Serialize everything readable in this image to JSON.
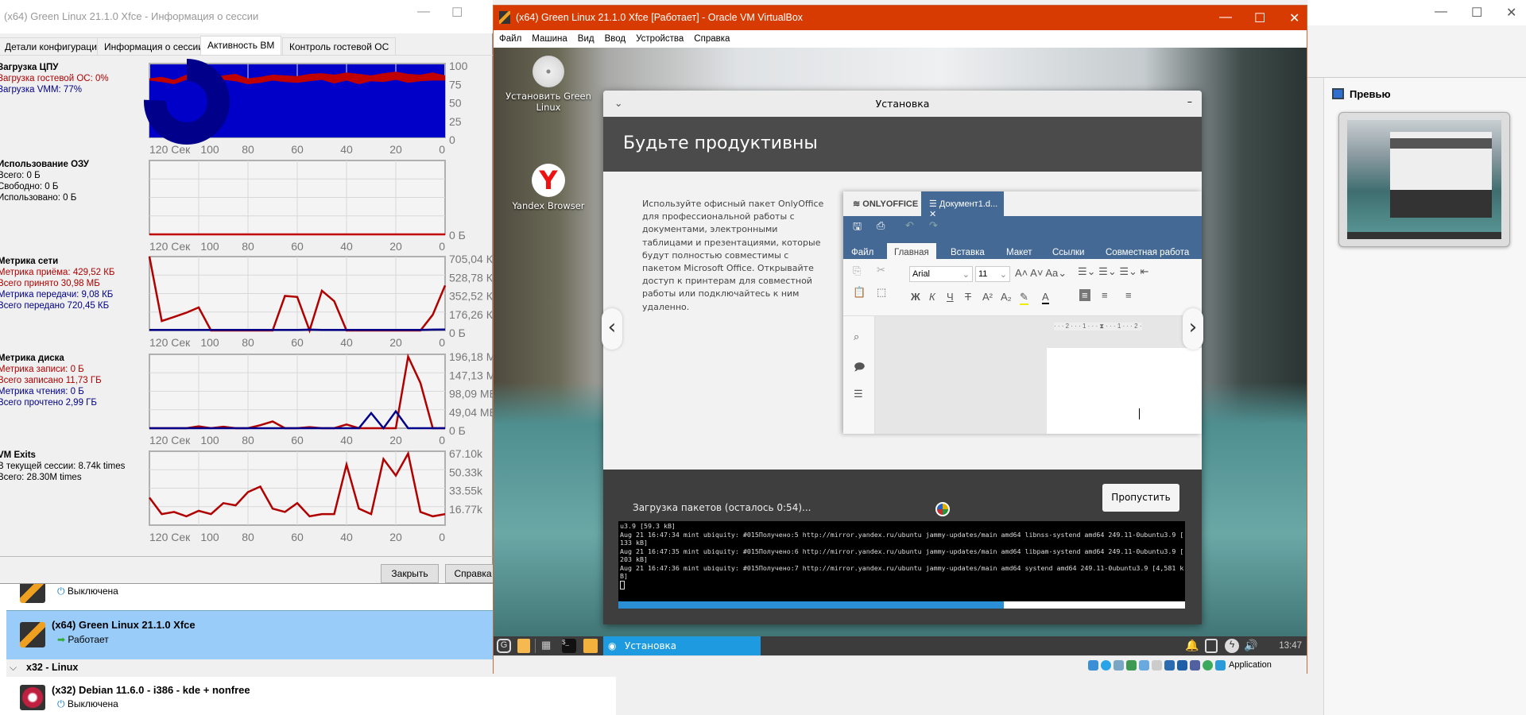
{
  "manager": {
    "preview_title": "Превью",
    "vm_list": [
      {
        "name": "",
        "state": "Выключена"
      },
      {
        "name": "(x64) Green Linux 21.1.0 Xfce",
        "state": "Работает",
        "selected": true
      },
      {
        "group": "x32 - Linux"
      },
      {
        "name": "(x32) Debian 11.6.0 - i386 - kde + nonfree",
        "state": "Выключена"
      }
    ]
  },
  "session_window": {
    "title": "(x64) Green Linux 21.1.0 Xfce - Информация о сессии",
    "tabs": [
      "Детали конфигурации",
      "Информация о сессии",
      "Активность ВМ",
      "Контроль гостевой ОС"
    ],
    "active_tab": "Активность ВМ",
    "buttons": {
      "close": "Закрыть",
      "help": "Справка"
    },
    "sections": {
      "cpu": {
        "title": "Загрузка ЦПУ",
        "lines": [
          "Загрузка гостевой ОС: 0%",
          "Загрузка VMM: 77%"
        ]
      },
      "ram": {
        "title": "Использование ОЗУ",
        "lines": [
          "Всего: 0 Б",
          "Свободно: 0 Б",
          "Использовано: 0 Б"
        ]
      },
      "net": {
        "title": "Метрика сети",
        "lines": [
          "Метрика приёма: 429,52 КБ",
          "Всего принято 30,98 МБ",
          "Метрика передачи: 9,08 КБ",
          "Всего передано 720,45 КБ"
        ]
      },
      "disk": {
        "title": "Метрика диска",
        "lines": [
          "Метрика записи: 0 Б",
          "Всего записано 11,73 ГБ",
          "Метрика чтения: 0 Б",
          "Всего прочтено 2,99 ГБ"
        ]
      },
      "exits": {
        "title": "VM Exits",
        "lines": [
          "В текущей сессии: 8.74k times",
          "Всего: 28.30M times"
        ]
      }
    }
  },
  "chart_data": [
    {
      "type": "area",
      "id": "cpu",
      "x_ticks": [
        "120 Сек",
        "100",
        "80",
        "60",
        "40",
        "20",
        "0"
      ],
      "y_ticks": [
        "100",
        "75",
        "50",
        "25",
        "0"
      ],
      "ylim": [
        0,
        100
      ],
      "xlim": [
        120,
        0
      ],
      "grid": true,
      "series": [
        {
          "values": [
            80,
            82,
            78,
            85,
            83,
            80,
            84,
            86,
            80,
            82,
            85,
            84,
            83,
            86,
            87,
            85,
            88,
            86,
            84,
            87,
            89,
            86,
            85,
            88,
            84
          ],
          "color": "#c00000"
        },
        {
          "values": [
            77,
            75,
            72,
            78,
            74,
            60,
            78,
            76,
            72,
            74,
            77,
            75,
            74,
            76,
            78,
            73,
            77,
            72,
            76,
            75,
            78,
            74,
            76,
            77,
            77
          ],
          "color": "#0000c8"
        }
      ]
    },
    {
      "type": "line",
      "id": "ram",
      "x_ticks": [
        "120 Сек",
        "100",
        "80",
        "60",
        "40",
        "20",
        "0"
      ],
      "y_ticks": [
        "0 Б"
      ],
      "grid": true,
      "series": [
        {
          "values": [
            0,
            0,
            0,
            0,
            0,
            0,
            0,
            0,
            0,
            0,
            0,
            0,
            0,
            0,
            0,
            0,
            0,
            0,
            0,
            0,
            0,
            0,
            0,
            0,
            0
          ],
          "color": "#c00000"
        }
      ],
      "ylim": [
        0,
        1
      ]
    },
    {
      "type": "line",
      "id": "net",
      "x_ticks": [
        "120 Сек",
        "100",
        "80",
        "60",
        "40",
        "20",
        "0"
      ],
      "y_ticks": [
        "705,04 КБ",
        "528,78 КБ",
        "352,52 КБ",
        "176,26 КБ",
        "0 Б"
      ],
      "ylim": [
        0,
        705.04
      ],
      "grid": true,
      "series": [
        {
          "values": [
            705,
            90,
            130,
            170,
            220,
            0,
            0,
            0,
            0,
            0,
            0,
            330,
            320,
            0,
            380,
            280,
            0,
            0,
            0,
            0,
            0,
            0,
            0,
            150,
            430
          ],
          "color": "#b00000"
        },
        {
          "values": [
            5,
            5,
            5,
            5,
            5,
            5,
            5,
            5,
            5,
            5,
            5,
            5,
            5,
            8,
            5,
            5,
            5,
            5,
            5,
            5,
            5,
            5,
            5,
            8,
            9
          ],
          "color": "#00008b"
        }
      ]
    },
    {
      "type": "line",
      "id": "disk",
      "x_ticks": [
        "120 Сек",
        "100",
        "80",
        "60",
        "40",
        "20",
        "0"
      ],
      "y_ticks": [
        "196,18 МБ",
        "147,13 МБ",
        "98,09 МБ",
        "49,04 МБ",
        "0 Б"
      ],
      "ylim": [
        0,
        196.18
      ],
      "grid": true,
      "series": [
        {
          "values": [
            0,
            0,
            0,
            0,
            5,
            0,
            4,
            0,
            0,
            8,
            18,
            0,
            0,
            3,
            0,
            0,
            10,
            0,
            0,
            0,
            0,
            190,
            120,
            0,
            0
          ],
          "color": "#b00000"
        },
        {
          "values": [
            0,
            0,
            0,
            0,
            0,
            0,
            0,
            0,
            0,
            0,
            0,
            0,
            0,
            0,
            0,
            0,
            0,
            0,
            40,
            0,
            45,
            0,
            0,
            0,
            0
          ],
          "color": "#00008b"
        }
      ]
    },
    {
      "type": "line",
      "id": "exits",
      "x_ticks": [
        "120 Сек",
        "100",
        "80",
        "60",
        "40",
        "20",
        "0"
      ],
      "y_ticks": [
        "67.10k",
        "50.33k",
        "33.55k",
        "16.77k"
      ],
      "ylim": [
        0,
        67.1
      ],
      "grid": true,
      "series": [
        {
          "values": [
            25,
            10,
            12,
            8,
            13,
            10,
            20,
            18,
            30,
            35,
            15,
            12,
            20,
            8,
            10,
            10,
            55,
            15,
            10,
            60,
            45,
            65,
            12,
            8,
            10
          ],
          "color": "#b00000"
        }
      ]
    }
  ],
  "vm_window": {
    "title": "(x64) Green Linux 21.1.0 Xfce [Работает] - Oracle VM VirtualBox",
    "menu": [
      "Файл",
      "Машина",
      "Вид",
      "Ввод",
      "Устройства",
      "Справка"
    ],
    "status_text": "Application",
    "accent": "#d83b01"
  },
  "guest": {
    "desktop_icons": [
      {
        "label": "Установить Green Linux",
        "icon": "disc-icon"
      },
      {
        "label": "Yandex Browser",
        "icon": "yandex-icon"
      }
    ],
    "installer": {
      "title": "Установка",
      "banner": "Будьте продуктивны",
      "paragraph": "Используйте офисный пакет OnlyOffice для профессиональной работы с документами, электронными таблицами и презентациями, которые будут полностью совместимы с пакетом Microsoft Office. Открывайте доступ к принтерам для совместной работы или подключайтесь к ним удаленно.",
      "status": "Загрузка пакетов (осталось 0:54)...",
      "skip": "Пропустить",
      "progress": 0.68,
      "terminal": [
        "u3.9 [59.3 kB]",
        "Aug 21 16:47:34 mint ubiquity: #015Получено:5 http://mirror.yandex.ru/ubuntu jammy-updates/main amd64 libnss-systend amd64 249.11-0ubuntu3.9 [",
        "133 kB]",
        "Aug 21 16:47:35 mint ubiquity: #015Получено:6 http://mirror.yandex.ru/ubuntu jammy-updates/main amd64 libpam-systend amd64 249.11-0ubuntu3.9 [",
        "203 kB]",
        "Aug 21 16:47:36 mint ubiquity: #015Получено:7 http://mirror.yandex.ru/ubuntu jammy-updates/main amd64 systend amd64 249.11-0ubuntu3.9 [4,581 k",
        "B]"
      ]
    },
    "onlyoffice": {
      "brand": "ONLYOFFICE",
      "doc_tab": "Документ1.d...",
      "ribbon_tabs": [
        "Файл",
        "Главная",
        "Вставка",
        "Макет",
        "Ссылки",
        "Совместная работа"
      ],
      "active_ribbon": "Главная",
      "font": "Arial",
      "size": "11",
      "format_buttons": [
        "Ж",
        "К",
        "Ч",
        "Т",
        "A²",
        "A₂"
      ],
      "ruler": "· · · 2 · · · 1 · · · ⧗ · · · 1 · · · 2 ·"
    },
    "taskbar": {
      "task": "Установка",
      "clock": "13:47"
    }
  }
}
